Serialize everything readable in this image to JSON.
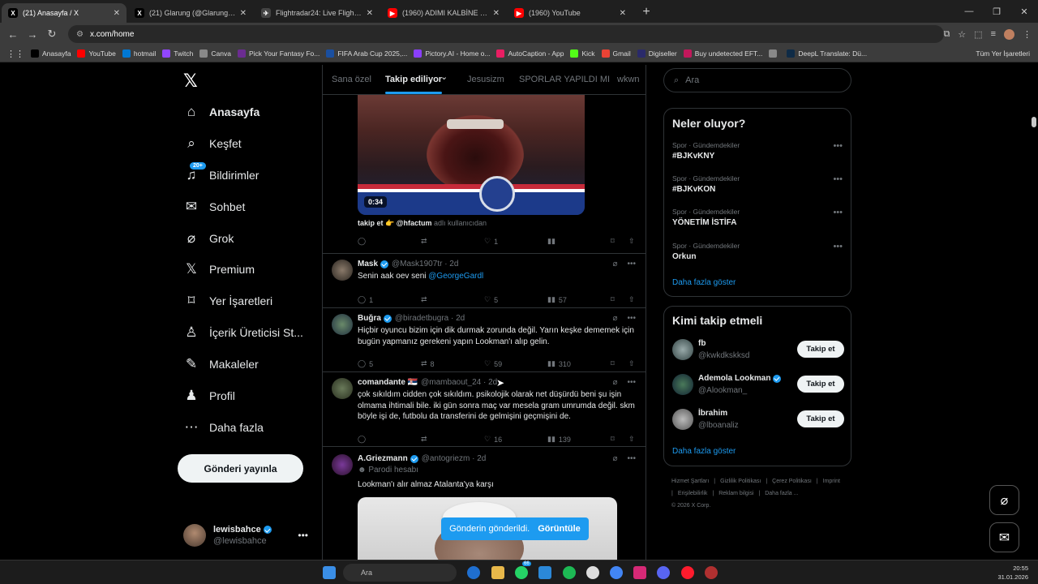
{
  "browser": {
    "tabs": [
      {
        "title": "(21) Anasayfa / X",
        "fav": "X",
        "favbg": "#000000",
        "active": true
      },
      {
        "title": "(21) Glarung (@GlarungYedek)",
        "fav": "X",
        "favbg": "#000000",
        "active": false
      },
      {
        "title": "Flightradar24: Live Flight Tracke",
        "fav": "✈",
        "favbg": "#444444",
        "active": false
      },
      {
        "title": "(1960) ADIMI KALBİNE YAZ X B",
        "fav": "▶",
        "favbg": "#ff0000",
        "active": false
      },
      {
        "title": "(1960) YouTube",
        "fav": "▶",
        "favbg": "#ff0000",
        "active": false
      }
    ],
    "url": "x.com/home",
    "bookmarks": [
      {
        "label": "Anasayfa",
        "color": "#000000"
      },
      {
        "label": "YouTube",
        "color": "#ff0000"
      },
      {
        "label": "hotmail",
        "color": "#0078d4"
      },
      {
        "label": "Twitch",
        "color": "#9146ff"
      },
      {
        "label": "Canva",
        "color": "#888888"
      },
      {
        "label": "Pick Your Fantasy Fo...",
        "color": "#6b2c91"
      },
      {
        "label": "FIFA Arab Cup 2025,...",
        "color": "#1a4fa0"
      },
      {
        "label": "Pictory.AI - Home o...",
        "color": "#8a3ffc"
      },
      {
        "label": "AutoCaption - App",
        "color": "#e91e63"
      },
      {
        "label": "Kick",
        "color": "#53fc18"
      },
      {
        "label": "Gmail",
        "color": "#ea4335"
      },
      {
        "label": "Digiseller",
        "color": "#2a2a6a"
      },
      {
        "label": "Buy undetected EFT...",
        "color": "#c2185b"
      },
      {
        "label": "",
        "color": "#888888"
      },
      {
        "label": "DeepL Translate: Dü...",
        "color": "#0f2b46"
      }
    ],
    "bookmarks_all": "Tüm Yer İşaretleri"
  },
  "nav": {
    "items": [
      {
        "label": "Anasayfa",
        "icon": "home-icon"
      },
      {
        "label": "Keşfet",
        "icon": "search-icon"
      },
      {
        "label": "Bildirimler",
        "icon": "bell-icon",
        "badge": "20+"
      },
      {
        "label": "Sohbet",
        "icon": "mail-icon"
      },
      {
        "label": "Grok",
        "icon": "grok-icon"
      },
      {
        "label": "Premium",
        "icon": "x-logo-icon"
      },
      {
        "label": "Yer İşaretleri",
        "icon": "bookmark-icon"
      },
      {
        "label": "İçerik Üreticisi St...",
        "icon": "creator-icon"
      },
      {
        "label": "Makaleler",
        "icon": "article-icon"
      },
      {
        "label": "Profil",
        "icon": "profile-icon"
      },
      {
        "label": "Daha fazla",
        "icon": "more-circle-icon"
      }
    ],
    "post_button": "Gönderi yayınla",
    "account": {
      "name": "lewisbahce",
      "handle": "@lewisbahce"
    }
  },
  "feed": {
    "tabs": [
      "Sana özel",
      "Takip ediliyor",
      "Jesusizm",
      "SPORLAR YAPILDI MI",
      "wkwn"
    ],
    "first": {
      "video_time": "0:34",
      "caption_main": "takip et 👉 @hfactum",
      "caption_tail": "adlı kullanıcıdan",
      "likes": "1"
    },
    "tweets": [
      {
        "name": "Mask",
        "handle": "@Mask1907tr · 2d",
        "verified": true,
        "text": "Senin aak oev seni ",
        "mention": "@GeorgeGardl",
        "replies": "1",
        "retweets": "",
        "likes": "5",
        "views": "57"
      },
      {
        "name": "Buğra",
        "handle": "@biradetbugra · 2d",
        "verified": true,
        "text": "Hiçbir oyuncu bizim için dik durmak zorunda değil. Yarın keşke dememek için bugün yapmanız gerekeni yapın Lookman'ı alıp gelin.",
        "replies": "5",
        "retweets": "8",
        "likes": "59",
        "views": "310"
      },
      {
        "name": "comandante 🇷🇸",
        "handle": "@mambaout_24 · 2d",
        "verified": false,
        "text": "çok sıkıldım cidden çok sıkıldım. psikolojik olarak net düşürdü beni şu işin olmama ihtimali bile. iki gün sonra maç var mesela gram umrumda değil. skm böyle işi de, futbolu da transferini de gelmişini geçmişini de.",
        "replies": "",
        "retweets": "",
        "likes": "16",
        "views": "139"
      },
      {
        "name": "A.Griezmann",
        "handle": "@antogriezm · 2d",
        "verified": true,
        "subline": "Parodi hesabı",
        "text": "Lookman'ı alır almaz Atalanta'ya karşı"
      }
    ],
    "toast": {
      "text": "Gönderin gönderildi.",
      "action": "Görüntüle"
    }
  },
  "right": {
    "search_placeholder": "Ara",
    "trends_title": "Neler oluyor?",
    "trends": [
      {
        "category": "Spor · Gündemdekiler",
        "topic": "#BJKvKNY"
      },
      {
        "category": "Spor · Gündemdekiler",
        "topic": "#BJKvKON"
      },
      {
        "category": "Spor · Gündemdekiler",
        "topic": "YÖNETİM İSTİFA"
      },
      {
        "category": "Spor · Gündemdekiler",
        "topic": "Orkun"
      }
    ],
    "trends_more": "Daha fazla göster",
    "who_title": "Kimi takip etmeli",
    "who": [
      {
        "name": "fb",
        "handle": "@kwkdkskksd",
        "verified": false,
        "button": "Takip et"
      },
      {
        "name": "Ademola Lookman",
        "handle": "@Alookman_",
        "verified": true,
        "button": "Takip et"
      },
      {
        "name": "İbrahim",
        "handle": "@lboanaliz",
        "verified": false,
        "button": "Takip et"
      }
    ],
    "who_more": "Daha fazla göster",
    "footer": [
      "Hizmet Şartları",
      "|",
      "Gizlilik Politikası",
      "|",
      "Çerez Politikası",
      "|",
      "Imprint",
      "|",
      "Erişilebilirlik",
      "|",
      "Reklam bilgisi",
      "|",
      "Daha fazla ...",
      "© 2026 X Corp."
    ]
  },
  "taskbar": {
    "search": "Ara",
    "time": "20:55",
    "date": "31.01.2026",
    "badge1": "66"
  }
}
